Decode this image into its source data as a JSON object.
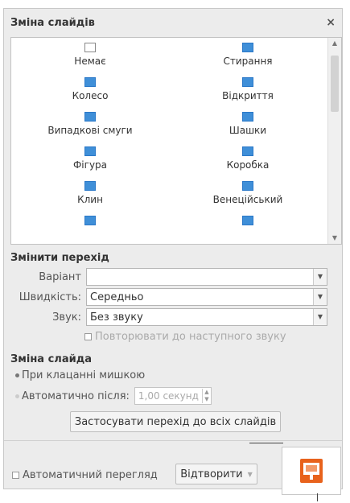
{
  "panel": {
    "title": "Зміна слайдів",
    "close": "×"
  },
  "transitions": [
    {
      "label": "Немає",
      "icon": "empty"
    },
    {
      "label": "Стирання",
      "icon": "wipe"
    },
    {
      "label": "Колесо",
      "icon": "wheel"
    },
    {
      "label": "Відкриття",
      "icon": "uncover"
    },
    {
      "label": "Випадкові смуги",
      "icon": "random-bars"
    },
    {
      "label": "Шашки",
      "icon": "checkers"
    },
    {
      "label": "Фігура",
      "icon": "shape"
    },
    {
      "label": "Коробка",
      "icon": "box"
    },
    {
      "label": "Клин",
      "icon": "wedge"
    },
    {
      "label": "Венеційський",
      "icon": "venetian"
    },
    {
      "label": "",
      "icon": "more-1"
    },
    {
      "label": "",
      "icon": "more-2"
    }
  ],
  "modify": {
    "title": "Змінити перехід",
    "variant_label": "Варіант",
    "variant_value": "",
    "speed_label": "Швидкість:",
    "speed_value": "Середньо",
    "sound_label": "Звук:",
    "sound_value": "Без звуку",
    "loop_label": "Повторювати до наступного звуку"
  },
  "advance": {
    "title": "Зміна слайда",
    "on_click": "При клацанні мишкою",
    "auto_label": "Автоматично після:",
    "auto_value": "1,00 секунд"
  },
  "apply_all": "Застосувати перехід до всіх слайдів",
  "bottom": {
    "auto_preview": "Автоматичний перегляд",
    "play": "Відтворити"
  },
  "colors": {
    "accent": "#3f8fd8",
    "app_icon": "#e8621c"
  }
}
